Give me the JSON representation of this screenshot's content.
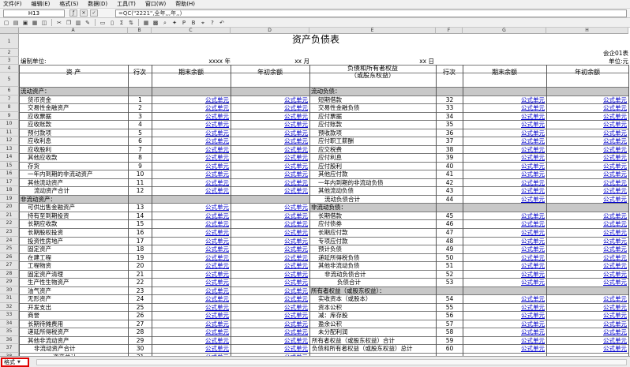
{
  "menu": [
    "文件(F)",
    "编辑(E)",
    "格式(S)",
    "数据(D)",
    "工具(T)",
    "窗口(W)",
    "帮助(H)"
  ],
  "formula_bar": {
    "cell_ref": "H13",
    "formula": "=QC(\"2221\",全年,,,年,,)"
  },
  "columns": [
    "A",
    "B",
    "C",
    "D",
    "E",
    "F",
    "G",
    "H"
  ],
  "row_numbers": [
    "1",
    "2",
    "3",
    "4",
    "5",
    "6",
    "7",
    "8",
    "9",
    "10",
    "11",
    "12",
    "13",
    "14",
    "15",
    "16",
    "17",
    "18",
    "19",
    "20",
    "21",
    "22",
    "23",
    "24",
    "25",
    "26",
    "27",
    "28",
    "29",
    "30",
    "31",
    "32",
    "33",
    "34",
    "35",
    "36",
    "37",
    "38"
  ],
  "sheet": {
    "title": "资产负债表",
    "form_no": "会企01表",
    "org_label": "编制单位:",
    "date_parts": [
      "xxxx 年",
      "xx 月",
      "xx 日"
    ],
    "unit_label": "单位:元",
    "headers": {
      "asset": "资        产",
      "line": "行次",
      "end_balance": "期末余额",
      "begin_balance": "年初余额",
      "liab_line1": "负债和所有者权益",
      "liab_line2": "（或股东权益）"
    },
    "cell_text": "公式单元",
    "left_rows": [
      {
        "label": "流动资产：",
        "line": "",
        "section": true
      },
      {
        "label": "货币资金",
        "line": "1"
      },
      {
        "label": "交易性金融资产",
        "line": "2"
      },
      {
        "label": "应收票据",
        "line": "3"
      },
      {
        "label": "应收账款",
        "line": "4"
      },
      {
        "label": "预付款项",
        "line": "5"
      },
      {
        "label": "应收利息",
        "line": "6"
      },
      {
        "label": "应收股利",
        "line": "7"
      },
      {
        "label": "其他应收款",
        "line": "8"
      },
      {
        "label": "存货",
        "line": "9"
      },
      {
        "label": "一年内到期的非流动资产",
        "line": "10"
      },
      {
        "label": "其他流动资产",
        "line": "11"
      },
      {
        "label": "流动资产合计",
        "line": "12",
        "indent": 2
      },
      {
        "label": "非流动资产：",
        "line": "",
        "section": true
      },
      {
        "label": "可供出售金融资产",
        "line": "13"
      },
      {
        "label": "持有至到期投资",
        "line": "14"
      },
      {
        "label": "长期应收款",
        "line": "15"
      },
      {
        "label": "长期股权投资",
        "line": "16"
      },
      {
        "label": "投资性房地产",
        "line": "17"
      },
      {
        "label": "固定资产",
        "line": "18"
      },
      {
        "label": "在建工程",
        "line": "19"
      },
      {
        "label": "工程物资",
        "line": "20"
      },
      {
        "label": "固定资产清理",
        "line": "21"
      },
      {
        "label": "生产性生物资产",
        "line": "22"
      },
      {
        "label": "油气资产",
        "line": "23"
      },
      {
        "label": "无形资产",
        "line": "24"
      },
      {
        "label": "开发支出",
        "line": "25"
      },
      {
        "label": "商誉",
        "line": "26"
      },
      {
        "label": "长期待摊费用",
        "line": "27"
      },
      {
        "label": "递延所得税资产",
        "line": "28"
      },
      {
        "label": "其他非流动资产",
        "line": "29"
      },
      {
        "label": "非流动资产合计",
        "line": "30",
        "indent": 2
      },
      {
        "label": "资产总计",
        "line": "31",
        "indent": 5
      }
    ],
    "right_rows": [
      {
        "label": "流动负债：",
        "line": "",
        "section": true
      },
      {
        "label": "短期借款",
        "line": "32"
      },
      {
        "label": "交易性金融负债",
        "line": "33"
      },
      {
        "label": "应付票据",
        "line": "34"
      },
      {
        "label": "应付账款",
        "line": "35"
      },
      {
        "label": "预收款项",
        "line": "36"
      },
      {
        "label": "应付职工薪酬",
        "line": "37"
      },
      {
        "label": "应交税费",
        "line": "38"
      },
      {
        "label": "应付利息",
        "line": "39"
      },
      {
        "label": "应付股利",
        "line": "40"
      },
      {
        "label": "其他应付款",
        "line": "41"
      },
      {
        "label": "一年内到期的非流动负债",
        "line": "42"
      },
      {
        "label": "其他流动负债",
        "line": "43"
      },
      {
        "label": "流动负债合计",
        "line": "44",
        "indent": 2
      },
      {
        "label": "非流动负债：",
        "line": "",
        "section": true
      },
      {
        "label": "长期借款",
        "line": "45"
      },
      {
        "label": "应付债券",
        "line": "46"
      },
      {
        "label": "长期应付款",
        "line": "47"
      },
      {
        "label": "专项应付款",
        "line": "48"
      },
      {
        "label": "预计负债",
        "line": "49"
      },
      {
        "label": "递延所得税负债",
        "line": "50"
      },
      {
        "label": "其他非流动负债",
        "line": "51"
      },
      {
        "label": "非流动负债合计",
        "line": "52",
        "indent": 2
      },
      {
        "label": "负债合计",
        "line": "53",
        "indent": 4
      },
      {
        "label": "所有者权益（或股东权益）：",
        "line": "",
        "section": true
      },
      {
        "label": "实收资本（或股本）",
        "line": "54"
      },
      {
        "label": "资本公积",
        "line": "55"
      },
      {
        "label": "减：库存股",
        "line": "56"
      },
      {
        "label": "盈余公积",
        "line": "57"
      },
      {
        "label": "未分配利润",
        "line": "58"
      },
      {
        "label": "所有者权益（或股东权益）合计",
        "line": "59",
        "indent": 0
      },
      {
        "label": "负债和所有者权益（或股东权益）总计",
        "line": "60",
        "indent": 0
      }
    ]
  },
  "sheet_tab": "格式"
}
